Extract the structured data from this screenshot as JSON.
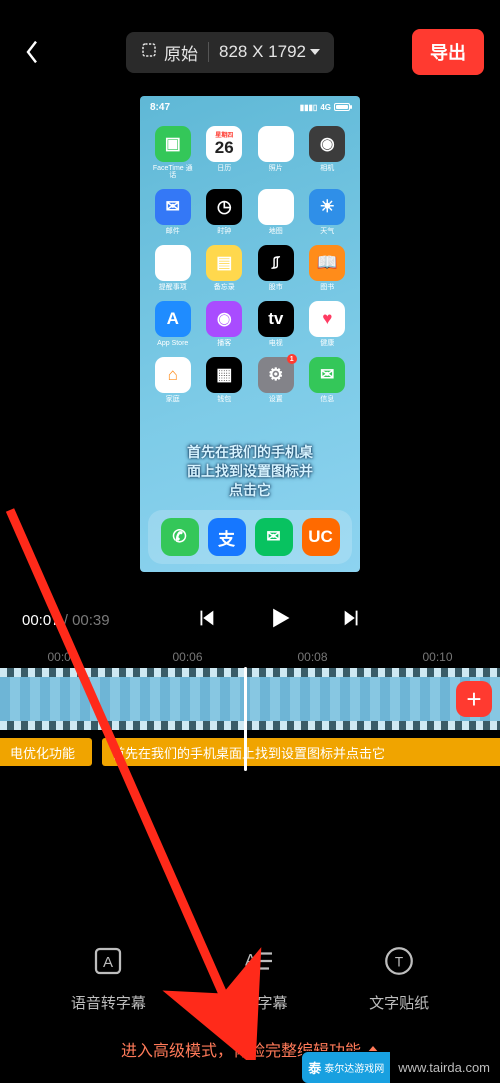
{
  "header": {
    "orientation_label": "原始",
    "dimensions_label": "828 X 1792",
    "export_label": "导出"
  },
  "phone": {
    "time": "8:47",
    "signal_text": "4G",
    "caption": "首先在我们的手机桌\n面上找到设置图标并\n点击它",
    "calendar": {
      "weekday": "星期四",
      "day": "26"
    },
    "apps": [
      {
        "label": "FaceTime 通话",
        "cls": "c-facetime",
        "glyph": "▣"
      },
      {
        "label": "日历",
        "cls": "c-cal",
        "glyph": ""
      },
      {
        "label": "照片",
        "cls": "c-photos",
        "glyph": "✿"
      },
      {
        "label": "相机",
        "cls": "c-cam",
        "glyph": "◉"
      },
      {
        "label": "邮件",
        "cls": "c-mail",
        "glyph": "✉"
      },
      {
        "label": "时钟",
        "cls": "c-clock",
        "glyph": "◷"
      },
      {
        "label": "地图",
        "cls": "c-maps",
        "glyph": "➤"
      },
      {
        "label": "天气",
        "cls": "c-weather",
        "glyph": "☀"
      },
      {
        "label": "提醒事项",
        "cls": "c-remind",
        "glyph": "≣"
      },
      {
        "label": "备忘录",
        "cls": "c-notes",
        "glyph": "▤"
      },
      {
        "label": "股市",
        "cls": "c-stocks",
        "glyph": "⎎"
      },
      {
        "label": "图书",
        "cls": "c-books",
        "glyph": "📖"
      },
      {
        "label": "App Store",
        "cls": "c-appst",
        "glyph": "A"
      },
      {
        "label": "播客",
        "cls": "c-pod",
        "glyph": "◉"
      },
      {
        "label": "电视",
        "cls": "c-tv",
        "glyph": "tv"
      },
      {
        "label": "健康",
        "cls": "c-health",
        "glyph": "♥"
      },
      {
        "label": "家庭",
        "cls": "c-home",
        "glyph": "⌂"
      },
      {
        "label": "钱包",
        "cls": "c-wallet",
        "glyph": "▦"
      },
      {
        "label": "设置",
        "cls": "c-settings",
        "glyph": "⚙",
        "badge": "1"
      },
      {
        "label": "信息",
        "cls": "c-msg",
        "glyph": "✉"
      }
    ],
    "dock": [
      {
        "name": "phone",
        "cls": "c-phone",
        "glyph": "✆"
      },
      {
        "name": "alipay",
        "cls": "c-ali",
        "glyph": "支"
      },
      {
        "name": "wechat",
        "cls": "c-wechat",
        "glyph": "✉"
      },
      {
        "name": "uc",
        "cls": "c-uc",
        "glyph": "UC"
      }
    ]
  },
  "playback": {
    "current": "00:07",
    "separator": " / ",
    "total": "00:39"
  },
  "timeline": {
    "ticks": [
      "00:04",
      "00:06",
      "00:08",
      "00:10"
    ],
    "sub_left": "电优化功能",
    "sub_right": "首先在我们的手机桌面上找到设置图标并点击它"
  },
  "tools": [
    {
      "id": "voice-sub",
      "label": "语音转字幕"
    },
    {
      "id": "movie-sub",
      "label": "电影字幕"
    },
    {
      "id": "sticker",
      "label": "文字贴纸"
    }
  ],
  "advanced_label": "进入高级模式，体验完整编辑功能",
  "watermark": {
    "logo_text": "泰",
    "site": "www.tairda.com",
    "brand": "泰尔达游戏网"
  }
}
